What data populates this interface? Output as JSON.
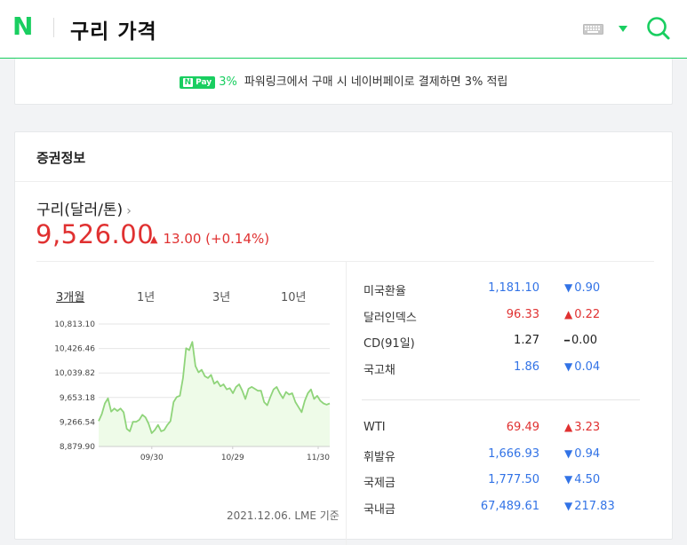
{
  "header": {
    "logo": "N",
    "query": "구리 가격"
  },
  "ad": {
    "badge_n": "N",
    "badge_pay": "Pay",
    "pct": "3%",
    "text": "파워링크에서 구매 시 네이버페이로 결제하면 3% 적립"
  },
  "card_title": "증권정보",
  "item": {
    "name": "구리(달러/톤)",
    "chevron": "›",
    "price": "9,526.00",
    "change_arrow": "▲",
    "change": "13.00 (+0.14%)"
  },
  "periods": [
    {
      "label": "3개월",
      "active": true
    },
    {
      "label": "1년",
      "active": false
    },
    {
      "label": "3년",
      "active": false
    },
    {
      "label": "10년",
      "active": false
    }
  ],
  "as_of": "2021.12.06. LME 기준",
  "colors": {
    "brand": "#19ce60",
    "up": "#e03131",
    "down": "#3273e6",
    "chart_line": "#8fd47a",
    "chart_fill": "#eefbe8"
  },
  "chart_data": {
    "type": "area",
    "x_tick_labels": [
      "09/30",
      "10/29",
      "11/30"
    ],
    "y_tick_labels": [
      "10,813.10",
      "10,426.46",
      "10,039.82",
      "9,653.18",
      "9,266.54",
      "8,879.90"
    ],
    "ylim": [
      8879.9,
      10813.1
    ],
    "grid": "horizontal",
    "values": [
      9280,
      9390,
      9560,
      9640,
      9430,
      9480,
      9440,
      9480,
      9420,
      9160,
      9120,
      9270,
      9270,
      9300,
      9380,
      9340,
      9240,
      9090,
      9140,
      9220,
      9120,
      9140,
      9220,
      9280,
      9580,
      9660,
      9680,
      9960,
      10430,
      10400,
      10530,
      10150,
      10050,
      10090,
      9990,
      9960,
      10010,
      9870,
      9910,
      9830,
      9860,
      9780,
      9800,
      9720,
      9820,
      9860,
      9760,
      9630,
      9790,
      9820,
      9790,
      9760,
      9760,
      9580,
      9530,
      9660,
      9780,
      9820,
      9720,
      9640,
      9740,
      9700,
      9720,
      9580,
      9500,
      9420,
      9600,
      9720,
      9780,
      9630,
      9680,
      9600,
      9560,
      9540,
      9560
    ]
  },
  "rates_group1": [
    {
      "name": "미국환율",
      "value": "1,181.10",
      "dir": "down",
      "arrow": "▼",
      "change": "0.90"
    },
    {
      "name": "달러인덱스",
      "value": "96.33",
      "dir": "up",
      "arrow": "▲",
      "change": "0.22"
    },
    {
      "name": "CD(91일)",
      "value": "1.27",
      "dir": "flat",
      "arrow": "━",
      "change": "0.00"
    },
    {
      "name": "국고채",
      "value": "1.86",
      "dir": "down",
      "arrow": "▼",
      "change": "0.04"
    }
  ],
  "rates_group2": [
    {
      "name": "WTI",
      "value": "69.49",
      "dir": "up",
      "arrow": "▲",
      "change": "3.23"
    },
    {
      "name": "휘발유",
      "value": "1,666.93",
      "dir": "down",
      "arrow": "▼",
      "change": "0.94"
    },
    {
      "name": "국제금",
      "value": "1,777.50",
      "dir": "down",
      "arrow": "▼",
      "change": "4.50"
    },
    {
      "name": "국내금",
      "value": "67,489.61",
      "dir": "down",
      "arrow": "▼",
      "change": "217.83"
    }
  ]
}
